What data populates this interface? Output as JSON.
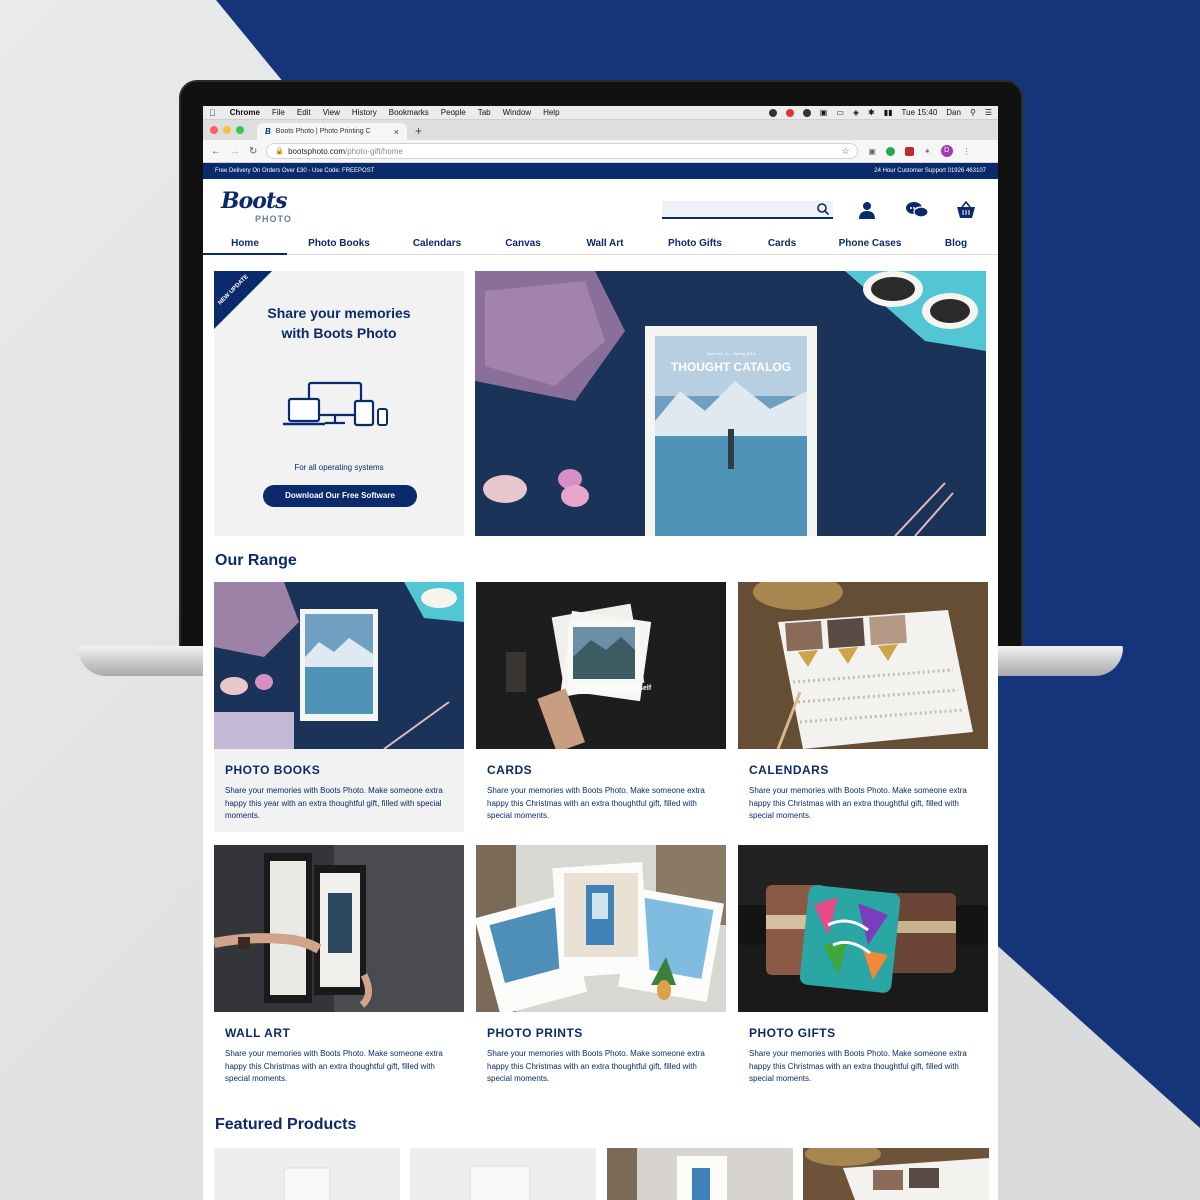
{
  "browser": {
    "mac_menu": [
      "Chrome",
      "File",
      "Edit",
      "View",
      "History",
      "Bookmarks",
      "People",
      "Tab",
      "Window",
      "Help"
    ],
    "clock": "Tue 15:40",
    "user": "Dan",
    "tab_title": "Boots Photo | Photo Printing C",
    "url_host": "bootsphoto.com",
    "url_path": "/photo-gift/home",
    "profile_initial": "D"
  },
  "promo_bar": {
    "left": "Free Delivery On Orders Over £30 - Use Code: FREEPOST",
    "right": "24 Hour Customer Support 01926 463107"
  },
  "header": {
    "logo_script": "Boots",
    "logo_sub": "PHOTO",
    "search_placeholder": ""
  },
  "nav": [
    "Home",
    "Photo Books",
    "Calendars",
    "Canvas",
    "Wall Art",
    "Photo Gifts",
    "Cards",
    "Phone Cases",
    "Blog"
  ],
  "hero": {
    "ribbon": "NEW UPDATE",
    "title_line1": "Share your memories",
    "title_line2": "with Boots Photo",
    "os_note": "For all operating systems",
    "button": "Download Our Free Software",
    "catalog_issue": "Issue No. 3 — Spring 2018",
    "catalog_title": "THOUGHT CATALOG"
  },
  "range": {
    "title": "Our Range",
    "items": [
      {
        "title": "PHOTO BOOKS",
        "text": "Share your memories with Boots Photo. Make someone extra happy this year with an extra thoughtful gift, filled with special moments."
      },
      {
        "title": "CARDS",
        "text": "Share your memories with Boots Photo. Make someone extra happy this Christmas with an extra thoughtful gift, filled with special moments."
      },
      {
        "title": "CALENDARS",
        "text": "Share your memories with Boots Photo. Make someone extra happy this Christmas with an extra thoughtful gift, filled with special moments."
      },
      {
        "title": "WALL ART",
        "text": "Share your memories with Boots Photo. Make someone extra happy this Christmas with an extra thoughtful gift, filled with special moments."
      },
      {
        "title": "PHOTO PRINTS",
        "text": "Share your memories with Boots Photo. Make someone extra happy this Christmas with an extra thoughtful gift, filled with special moments."
      },
      {
        "title": "PHOTO GIFTS",
        "text": "Share your memories with Boots Photo. Make someone extra happy this Christmas with an extra thoughtful gift, filled with special moments."
      }
    ],
    "card_texts": {
      "cards_overlay": "Uncomplicate Yourself"
    }
  },
  "featured": {
    "title": "Featured Products"
  },
  "colors": {
    "brand_navy": "#0b2a6b",
    "backdrop_blue": "#16347a"
  }
}
